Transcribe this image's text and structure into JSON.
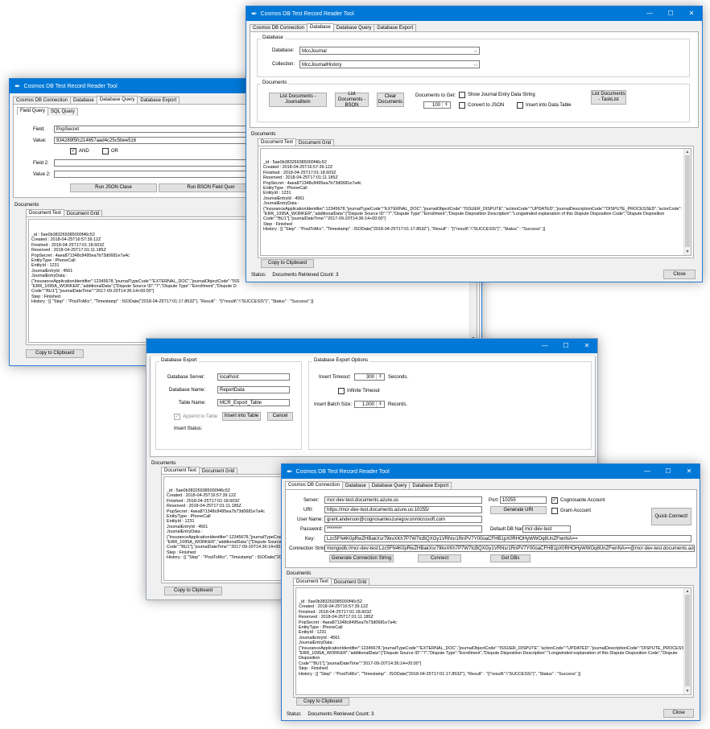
{
  "common": {
    "app_title": "Cosmos DB Test Record Reader Tool",
    "tabs": [
      "Cosmos DB Connection",
      "Database",
      "Database Query",
      "Database Export"
    ],
    "documents_label": "Documents",
    "doc_tabs": [
      "Document Text",
      "Document Grid"
    ],
    "copy_button": "Copy to Clipboard",
    "close_button": "Close",
    "status_label": "Status:",
    "status_value": "Documents Retrieved Count: 3",
    "minimize_glyph": "—",
    "maximize_glyph": "☐",
    "close_glyph": "✕",
    "scroll_up": "▲",
    "scroll_down": "▼",
    "combo_arrow": "⌵",
    "check_glyph": "✓"
  },
  "doc_lines_short": [
    "_id : 5ae0b383269385000f46c52",
    "Created : 2018-04-25T16:57:39.12Z",
    "Finished : 2018-04-25T17:01:18.603Z",
    "Reserved : 2018-04-25T17:01:11.185Z",
    "PopSecret : 4aea871348c8495ea7b73d0681e7a4c",
    "EntityType : PhoneCall",
    "EntityId : 1231",
    "JournalEntryId : 4561",
    "JournalEntryData :",
    "{\"insuranceApplicationIdentifier\":12345678,\"journalTypeCode\":\"EXTERNAL_DOC\",\"journalObjectCode\":\"ISS",
    "\"ERR_1095A_WORKER\",\"additionalData\":[\"Dispute Source ID\":\"7\",\"Dispute Type\":\"Enrollment\",\"Dispute D",
    "Code\":\"BU1\"],\"journalDateTime\":\"2017-09-20T14:36:14+00:00\"}",
    "Step : Finished",
    "History : [{ \"Step\" : \"PostToMcr\", \"Timestamp\" : ISODate(\"2018-04-25T17:01:17.853Z\"), \"Result\" : \"{\\\"result\\\":\\\"SUCCESS\\\"}\", \"Status\" : \"Success\" }]"
  ],
  "doc_lines_long": [
    "_id : 5ae0b383269385000f46c52",
    "Created : 2018-04-25T16:57:39.12Z",
    "Finished : 2018-04-25T17:01:18.603Z",
    "Reserved : 2018-04-25T17:01:11.185Z",
    "PopSecret : 4aea871348c8495ea7b73d0681e7a4c",
    "EntityType : PhoneCall",
    "EntityId : 1231",
    "JournalEntryId : 4561",
    "JournalEntryData :",
    "{\"insuranceApplicationIdentifier\":12345678,\"journalTypeCode\":\"EXTERNAL_DOC\",\"journalObjectCode\":\"ISSUER_DISPUTE\",\"actionCode\":\"UPDATED\",\"journalDescriptionCode\":\"DISPUTE_PROCESSED\",\"actorCode\":",
    "\"ERR_1095A_WORKER\",\"additionalData\":[\"Dispute Source ID\":\"7\",\"Dispute Type\":\"Enrollment\",\"Dispute Disposition Description\":\"Longwinded explanation of this Dispute Disposition Code\",\"Dispute Disposition",
    "Code\":\"BU1\"],\"journalDateTime\":\"2017-09-20T14:36:14+00:00\"}",
    "Step : Finished",
    "History : [{ \"Step\" : \"PostToMcr\", \"Timestamp\" : ISODate(\"2018-04-25T17:01:17.853Z\"), \"Result\" : \"{\\\"result\\\":\\\"SUCCESS\\\"}\", \"Status\" : \"Success\" }]"
  ],
  "query_win": {
    "subtabs": [
      "Field Query",
      "SQL Query"
    ],
    "field_label": "Field:",
    "field_value": "PopSecret",
    "value_label": "Value:",
    "value_value": "934289f5fc214657aad4c25c5bee516",
    "and_label": "AND",
    "or_label": "OR",
    "field2_label": "Field 2:",
    "value2_label": "Value 2:",
    "run_json": "Run JSON Clase",
    "run_bson": "Run BSON Field Quer"
  },
  "db_win": {
    "database_group": "Database",
    "database_label": "Database:",
    "database_value": "MccJournal",
    "collection_label": "Collection:",
    "collection_value": "MccJournalHistory",
    "documents_group": "Documents",
    "list_journalitem": "List Documents - JournalItem",
    "list_bson": "List Documents - BSON",
    "clear_docs": "Clear Documents",
    "docs_to_get_label": "Documents to Get:",
    "docs_to_get_value": "100",
    "show_journal": "Show Journal Entry Data String",
    "convert_json": "Convert to JSON",
    "insert_table": "Insert into Data Table",
    "list_tasklist": "List Documents - TaskList"
  },
  "export_win": {
    "export_group": "Database Export",
    "server_label": "Database Server:",
    "server_value": "localhost",
    "name_label": "Database Name:",
    "name_value": "ReportData",
    "table_label": "Table Name:",
    "table_value": "MCR_Export_Table",
    "append_label": "Append to Table",
    "insert_btn": "Insert into Table",
    "cancel_btn": "Cancel",
    "insert_status_label": "Insert Status:",
    "options_group": "Database Export Options",
    "timeout_label": "Insert Timeout:",
    "timeout_value": "300",
    "timeout_unit": "Seconds.",
    "infinite_label": "Infinite Timeout",
    "batch_label": "Insert Batch Size:",
    "batch_value": "1,000",
    "batch_unit": "Records."
  },
  "conn_win": {
    "server_label": "Server:",
    "server_value": "mcr-dev-test.documents.azure.us",
    "uri_label": "URI:",
    "uri_value": "https://mcr-dev-test.documents.azure.us:10255/",
    "user_label": "User Name:",
    "user_value": "grant.anderson@cognosanteszuregov.onmicrosoft.com",
    "password_label": "Password:",
    "password_value": "********",
    "key_label": "Key:",
    "key_value": "Lzc5FN4K0pRwZHBakXsr79kvXKh7P7W7tcBQXGy1VRNsr1RnPV7Y00oaCFHB1pX0RHOHyWWOq8UnZFwnNA==",
    "connstr_label": "Connection String:",
    "connstr_value": "mongodb://mcr-dev-test:Lzc5FN4K0pRwZHBakXsr79kvXKh7P7W7tcBQXGy1VRNsr1RnPV7Y00oaCFHB1pX0RHOHyWWOq8UnZFwnNA==@mcr-dev-test.documents.azure.us:10255/?ssl=true&replica",
    "gen_connstr": "Generate Connection String",
    "connect": "Connect",
    "get_dbs": "Get DBs",
    "port_label": "Port:",
    "port_value": "10255",
    "gen_uri": "Generate URI",
    "default_db_label": "Default DB Name:",
    "default_db_value": "mcr-dev-test",
    "cognosante_label": "Cognosante Account",
    "gram_label": "Gram Account",
    "quick_connect": "Quick Connect!"
  }
}
